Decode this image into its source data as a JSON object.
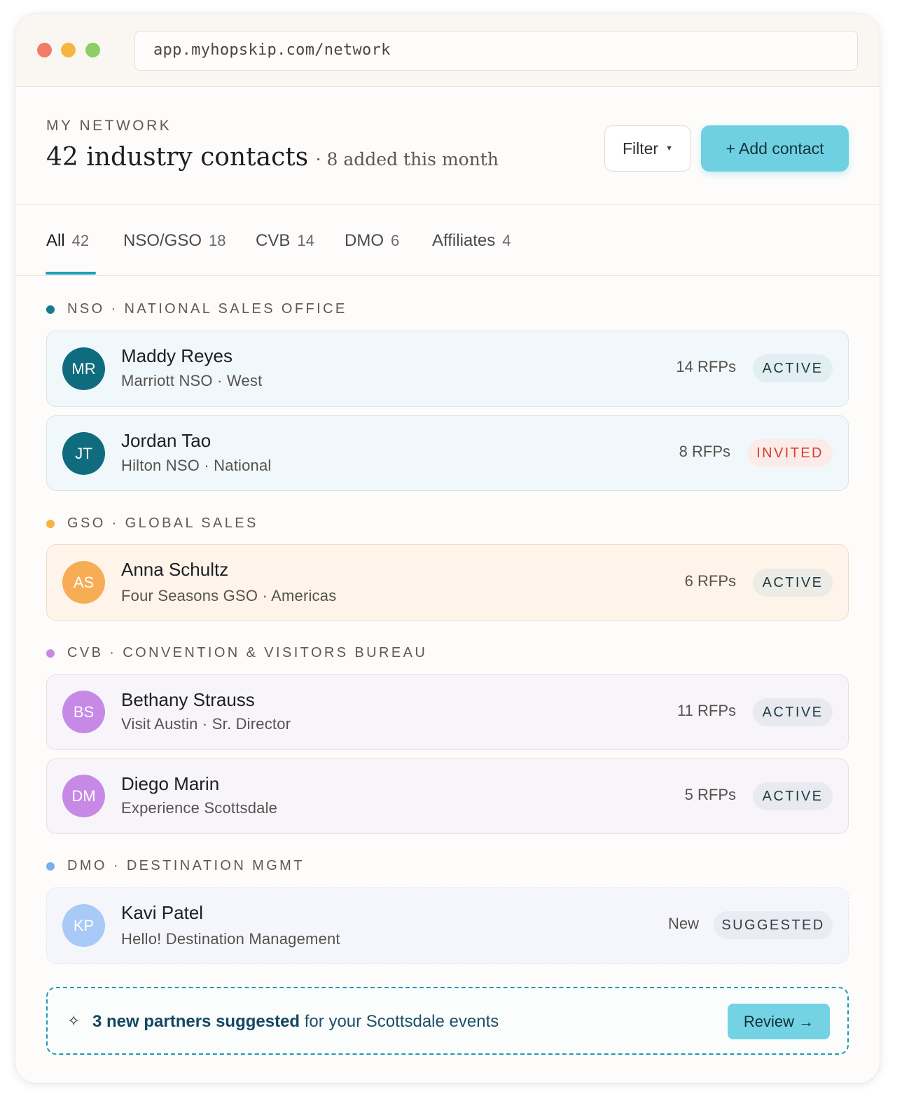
{
  "browser": {
    "url": "app.myhopskip.com/network"
  },
  "header": {
    "eyebrow": "MY NETWORK",
    "title": "42 industry contacts",
    "subtitle": "· 8 added this month",
    "filter_label": "Filter",
    "add_contact_label": "+ Add contact"
  },
  "tabs": [
    {
      "label": "All",
      "count": "42",
      "active": true
    },
    {
      "label": "NSO/GSO",
      "count": "18",
      "active": false
    },
    {
      "label": "CVB",
      "count": "14",
      "active": false
    },
    {
      "label": "DMO",
      "count": "6",
      "active": false
    },
    {
      "label": "Affiliates",
      "count": "4",
      "active": false
    }
  ],
  "sections": {
    "nso": {
      "label": "NSO · NATIONAL SALES OFFICE",
      "color": "#147a8c"
    },
    "gso": {
      "label": "GSO · GLOBAL SALES",
      "color": "#f5b53f"
    },
    "cvb": {
      "label": "CVB · CONVENTION & VISITORS BUREAU",
      "color": "#c98be0"
    },
    "dmo": {
      "label": "DMO · DESTINATION MGMT",
      "color": "#7aaef0"
    }
  },
  "contacts": [
    {
      "initials": "MR",
      "name": "Maddy Reyes",
      "org": "Marriott NSO · West",
      "rfps": "14 RFPs",
      "status": "ACTIVE",
      "avatar_color": "#0f6c7e"
    },
    {
      "initials": "JT",
      "name": "Jordan Tao",
      "org": "Hilton NSO · National",
      "rfps": "8 RFPs",
      "status": "INVITED",
      "avatar_color": "#0f6c7e"
    },
    {
      "initials": "AS",
      "name": "Anna Schultz",
      "org": "Four Seasons GSO · Americas",
      "rfps": "6 RFPs",
      "status": "ACTIVE",
      "avatar_color": "#f7ad55"
    },
    {
      "initials": "BS",
      "name": "Bethany Strauss",
      "org": "Visit Austin · Sr. Director",
      "rfps": "11 RFPs",
      "status": "ACTIVE",
      "avatar_color": "#c68ae6"
    },
    {
      "initials": "DM",
      "name": "Diego Marin",
      "org": "Experience Scottsdale",
      "rfps": "5 RFPs",
      "status": "ACTIVE",
      "avatar_color": "#c68ae6"
    },
    {
      "initials": "KP",
      "name": "Kavi Patel",
      "org": "Hello! Destination Management",
      "rfps": "New",
      "status": "SUGGESTED",
      "avatar_color": "#a9c9f6"
    }
  ],
  "banner": {
    "icon": "sparkle-icon",
    "highlight": "3 new partners suggested",
    "rest": " for your Scottsdale events",
    "review_label": "Review →"
  }
}
